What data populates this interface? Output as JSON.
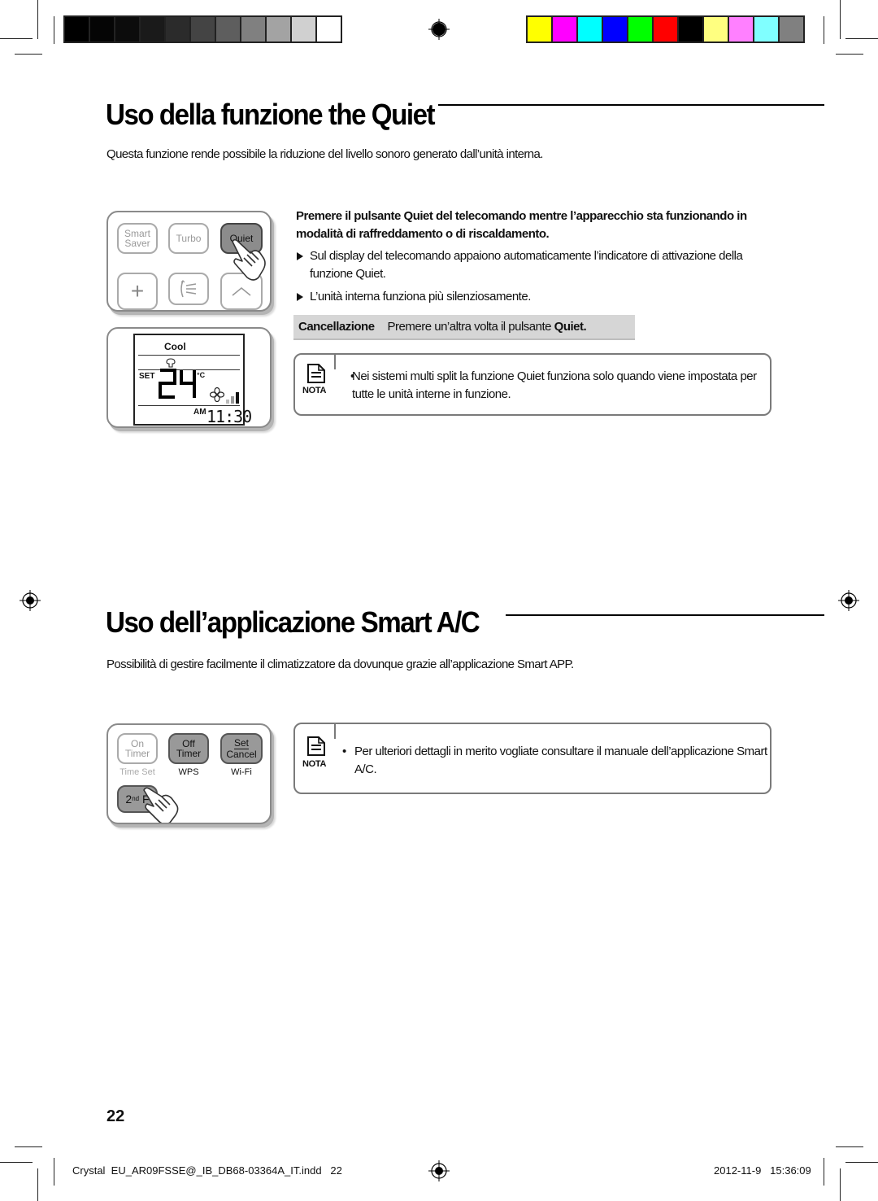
{
  "print_marks": {
    "grayscale_swatches": [
      "#000000",
      "#050505",
      "#0c0c0c",
      "#1a1a1a",
      "#2b2b2b",
      "#444444",
      "#5e5e5e",
      "#808080",
      "#a3a3a3",
      "#d0d0d0",
      "#ffffff"
    ],
    "color_swatches": [
      "#ffff00",
      "#ff00ff",
      "#00ffff",
      "#0000ff",
      "#00ff00",
      "#ff0000",
      "#000000",
      "#ffff80",
      "#ff80ff",
      "#80ffff",
      "#808080"
    ]
  },
  "section_quiet": {
    "title": "Uso della funzione the Quiet",
    "intro": "Questa funzione rende possibile la riduzione del livello sonoro generato dall’unità interna.",
    "remote_buttons": {
      "smart_saver_line1": "Smart",
      "smart_saver_line2": "Saver",
      "turbo": "Turbo",
      "quiet": "Quiet",
      "plus": "+",
      "up": "^"
    },
    "display": {
      "mode": "Cool",
      "set_label": "SET",
      "temperature": "24",
      "unit": "°C",
      "ampm": "AM",
      "time": "11:30"
    },
    "instruction": "Premere il pulsante Quiet del telecomando mentre l’apparecchio sta funzionando in modalità di raffreddamento o di riscaldamento.",
    "bullets": [
      "Sul display del telecomando appaiono automaticamente l’indicatore  di attivazione della funzione Quiet.",
      "L’unità interna funziona più silenziosamente."
    ],
    "cancel": {
      "label": "Cancellazione",
      "text": "Premere un’altra volta il pulsante ",
      "bold_text": "Quiet."
    },
    "note": {
      "label": "NOTA",
      "bullet": "•",
      "text": "Nei sistemi multi split la funzione Quiet funziona solo quando viene impostata per tutte le unità interne in funzione."
    }
  },
  "section_smart": {
    "title": "Uso dell’applicazione Smart A/C",
    "intro": "Possibilità di gestire facilmente il climatizzatore da dovunque grazie all’applicazione Smart APP.",
    "remote_buttons": {
      "on_timer_line1": "On",
      "on_timer_line2": "Timer",
      "on_timer_sub": "Time Set",
      "off_timer_line1": "Off",
      "off_timer_line2": "Timer",
      "off_timer_sub": "WPS",
      "set_cancel_line1": "Set",
      "set_cancel_line2": "Cancel",
      "set_cancel_sub": "Wi-Fi",
      "second_f": "2",
      "second_f_sup": "nd",
      "second_f_tail": " F"
    },
    "note": {
      "label": "NOTA",
      "bullet": "•",
      "text": "Per ulteriori dettagli in merito vogliate consultare il manuale dell’applicazione Smart A/C."
    }
  },
  "page_number": "22",
  "footer": {
    "file": "Crystal  EU_AR09FSSE@_IB_DB68-03364A_IT.indd   22",
    "timestamp": "2012-11-9   15:36:09"
  }
}
